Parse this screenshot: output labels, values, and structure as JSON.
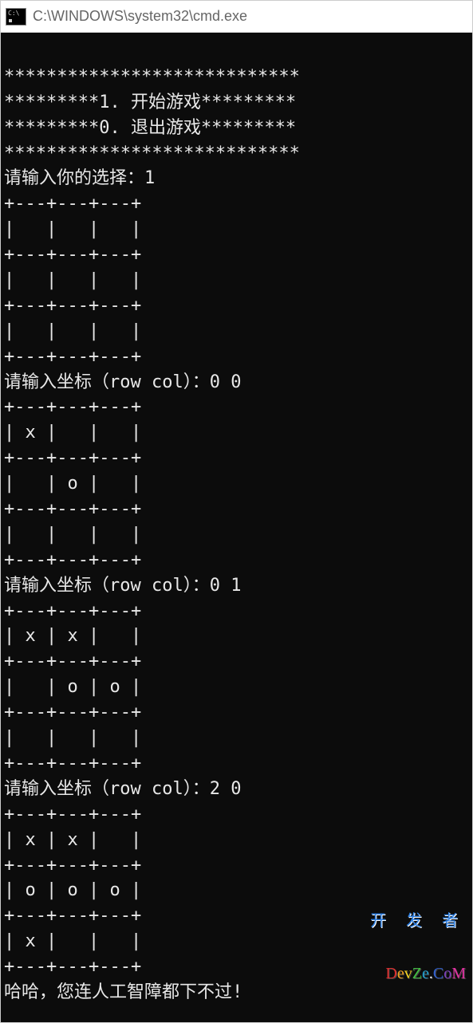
{
  "window": {
    "title": "C:\\WINDOWS\\system32\\cmd.exe"
  },
  "menu": {
    "border": "****************************",
    "option1": "*********1. 开始游戏*********",
    "option0": "*********0. 退出游戏*********",
    "prompt": "请输入你的选择：",
    "choice": "1"
  },
  "coord_prompt": "请输入坐标（row col）：",
  "moves": [
    {
      "input": "0 0"
    },
    {
      "input": "0 1"
    },
    {
      "input": "2 0"
    }
  ],
  "boards": {
    "hsep": "+---+---+---+",
    "empty_row": "|   |   |   |",
    "b0": [
      "|   |   |   |",
      "|   |   |   |",
      "|   |   |   |"
    ],
    "b1": [
      "| x |   |   |",
      "|   | o |   |",
      "|   |   |   |"
    ],
    "b2": [
      "| x | x |   |",
      "|   | o | o |",
      "|   |   |   |"
    ],
    "b3": [
      "| x | x |   |",
      "| o | o | o |",
      "| x |   |   |"
    ]
  },
  "result": "哈哈，您连人工智障都下不过!",
  "watermark": {
    "line1": "开 发 者",
    "brand": "DevZe.CoM"
  }
}
